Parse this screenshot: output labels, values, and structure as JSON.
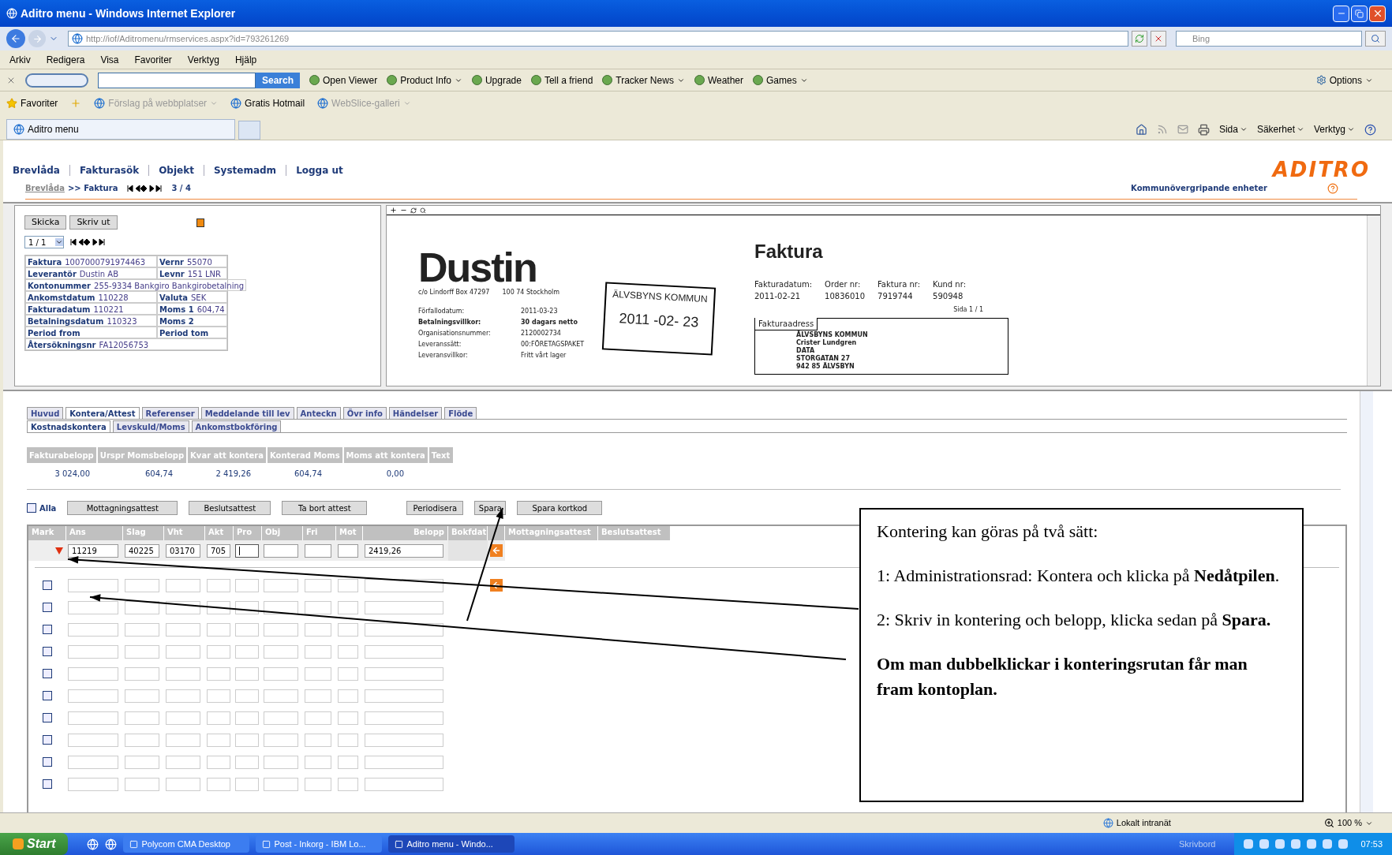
{
  "window": {
    "title": "Aditro menu - Windows Internet Explorer"
  },
  "address_bar": {
    "url": "http://iof/Aditromenu/rmservices.aspx?id=793261269"
  },
  "search_box": {
    "placeholder": "Bing"
  },
  "menu_bar": [
    "Arkiv",
    "Redigera",
    "Visa",
    "Favoriter",
    "Verktyg",
    "Hjälp"
  ],
  "tracker_toolbar": {
    "search_button": "Search",
    "options": "Options",
    "items": [
      {
        "label": "Open Viewer",
        "dropdown": false
      },
      {
        "label": "Product Info",
        "dropdown": true
      },
      {
        "label": "Upgrade",
        "dropdown": false
      },
      {
        "label": "Tell a friend",
        "dropdown": false
      },
      {
        "label": "Tracker News",
        "dropdown": true
      },
      {
        "label": "Weather",
        "dropdown": false
      },
      {
        "label": "Games",
        "dropdown": true
      }
    ]
  },
  "favorites_bar": {
    "favorites": "Favoriter",
    "items": [
      {
        "label": "Förslag på webbplatser",
        "dropdown": true,
        "disabled": true
      },
      {
        "label": "Gratis Hotmail",
        "dropdown": false,
        "disabled": false
      },
      {
        "label": "WebSlice-galleri",
        "dropdown": true,
        "disabled": true
      }
    ]
  },
  "browser_tabs": [
    {
      "label": "Aditro menu",
      "selected": true
    }
  ],
  "command_bar": [
    "Sida",
    "Säkerhet",
    "Verktyg"
  ],
  "page": {
    "nav": [
      "Brevlåda",
      "Fakturasök",
      "Objekt",
      "Systemadm",
      "Logga ut"
    ],
    "breadcrumb": {
      "link": "Brevlåda",
      "separator": ">>",
      "current": "Faktura",
      "counter": "3 / 4"
    },
    "brand": "ADITRO",
    "unit": "Kommunövergripande enheter"
  },
  "invoice_panel": {
    "buttons": [
      "Skicka",
      "Skriv ut"
    ],
    "page_select": "1 / 1",
    "rows": [
      [
        {
          "label": "Faktura",
          "value": "1007000791974463"
        },
        {
          "label": "Vernr",
          "value": "55070"
        }
      ],
      [
        {
          "label": "Leverantör",
          "value": "Dustin AB"
        },
        {
          "label": "Levnr",
          "value": "151 LNR"
        }
      ],
      [
        {
          "label": "Kontonummer",
          "value": "255-9334 Bankgiro Bankgirobetalning"
        }
      ],
      [
        {
          "label": "Ankomstdatum",
          "value": "110228"
        },
        {
          "label": "Valuta",
          "value": "SEK"
        }
      ],
      [
        {
          "label": "Fakturadatum",
          "value": "110221"
        },
        {
          "label": "Moms 1",
          "value": "604,74"
        }
      ],
      [
        {
          "label": "Betalningsdatum",
          "value": "110323"
        },
        {
          "label": "Moms 2"
        }
      ],
      [
        {
          "label": "Period from"
        },
        {
          "label": "Period tom"
        }
      ],
      [
        {
          "label": "Återsökningsnr",
          "value": "FA12056753"
        }
      ]
    ]
  },
  "document": {
    "company": "Dustin",
    "company_address": "c/o Lindorff Box 47297",
    "city": "100 74 Stockholm",
    "title": "Faktura",
    "meta": [
      {
        "label": "Fakturadatum:",
        "value": "2011-02-21"
      },
      {
        "label": "Order nr:",
        "value": "10836010"
      },
      {
        "label": "Faktura nr:",
        "value": "7919744"
      },
      {
        "label": "Kund nr:",
        "value": "590948"
      }
    ],
    "page": "Sida 1 / 1",
    "terms": [
      {
        "label": "Förfallodatum:",
        "value": "2011-03-23",
        "bold": false
      },
      {
        "label": "Betalningsvillkor:",
        "value": "30 dagars netto",
        "bold": true
      },
      {
        "label": "Organisationsnummer:",
        "value": "2120002734",
        "bold": false
      },
      {
        "label": "Leveranssätt:",
        "value": "00:FÖRETAGSPAKET",
        "bold": false
      },
      {
        "label": "Leveransvillkor:",
        "value": "Fritt vårt lager",
        "bold": false
      }
    ],
    "stamp": {
      "org": "ÄLVSBYNS KOMMUN",
      "date": "2011 -02- 23"
    },
    "address_heading": "Fakturaadress",
    "address": [
      "ÄLVSBYNS KOMMUN",
      "Crister Lundgren",
      "DATA",
      "STORGATAN 27",
      "942 85 ÄLVSBYN"
    ]
  },
  "tabs": [
    {
      "label": "Huvud",
      "selected": false
    },
    {
      "label": "Kontera/Attest",
      "selected": true
    },
    {
      "label": "Referenser",
      "selected": false
    },
    {
      "label": "Meddelande till lev",
      "selected": false
    },
    {
      "label": "Anteckn",
      "selected": false
    },
    {
      "label": "Övr info",
      "selected": false
    },
    {
      "label": "Händelser",
      "selected": false
    },
    {
      "label": "Flöde",
      "selected": false
    }
  ],
  "subtabs": [
    {
      "label": "Kostnadskontera",
      "selected": true
    },
    {
      "label": "Levskuld/Moms",
      "selected": false
    },
    {
      "label": "Ankomstbokföring",
      "selected": false
    }
  ],
  "summary": {
    "columns": [
      "Fakturabelopp",
      "Urspr Momsbelopp",
      "Kvar att kontera",
      "Konterad Moms",
      "Moms att kontera",
      "Text"
    ],
    "values": [
      "3 024,00",
      "604,74",
      "2 419,26",
      "604,74",
      "0,00"
    ]
  },
  "actions": {
    "select_all": {
      "label": "Alla",
      "checked": false
    },
    "buttons": [
      "Mottagningsattest",
      "Beslutsattest",
      "Ta bort attest",
      "Periodisera",
      "Spara",
      "Spara kortkod"
    ]
  },
  "grid": {
    "columns": [
      "Mark",
      "Ans",
      "Slag",
      "Vht",
      "Akt",
      "Pro",
      "Obj",
      "Fri",
      "Mot",
      "Belopp",
      "Bokfdat",
      "Mottagningsattest",
      "Beslutsattest"
    ],
    "admin_row": [
      {
        "value": "11219",
        "focused": false
      },
      {
        "value": "40225",
        "focused": false
      },
      {
        "value": "03170",
        "focused": false
      },
      {
        "value": "705",
        "focused": false
      },
      {
        "focused": true
      },
      {
        "focused": false
      },
      {
        "focused": false
      },
      {
        "focused": false
      },
      {
        "value": "2419,26",
        "focused": false
      }
    ],
    "entry_rows": [
      {
        "checked": false,
        "action_icon": true
      },
      {
        "checked": false,
        "action_icon": false
      },
      {
        "checked": false,
        "action_icon": false
      },
      {
        "checked": false,
        "action_icon": false
      },
      {
        "checked": false,
        "action_icon": false
      },
      {
        "checked": false,
        "action_icon": false
      },
      {
        "checked": false,
        "action_icon": false
      },
      {
        "checked": false,
        "action_icon": false
      },
      {
        "checked": false,
        "action_icon": false
      },
      {
        "checked": false,
        "action_icon": false
      }
    ]
  },
  "annotation": {
    "paragraphs": [
      {
        "text": "Kontering kan göras på två sätt:",
        "bold": false
      },
      {
        "text": "1: Administrationsrad: Kontera och klicka på **Nedåtpilen**.",
        "bold": false
      },
      {
        "text": "2: Skriv in kontering och belopp, klicka sedan på **Spara.**",
        "bold": false
      },
      {
        "text": "Om man dubbelklickar i konteringsrutan får man fram kontoplan.",
        "bold": true
      }
    ]
  },
  "status_bar": {
    "zone": "Lokalt intranät",
    "zoom": "100 %"
  },
  "taskbar": {
    "start": "Start",
    "tasks": [
      {
        "label": "Polycom CMA Desktop",
        "selected": false
      },
      {
        "label": "Post - Inkorg - IBM Lo...",
        "selected": false
      },
      {
        "label": "Aditro menu - Windo...",
        "selected": true
      }
    ],
    "desktop": "Skrivbord",
    "clock": "07:53"
  }
}
